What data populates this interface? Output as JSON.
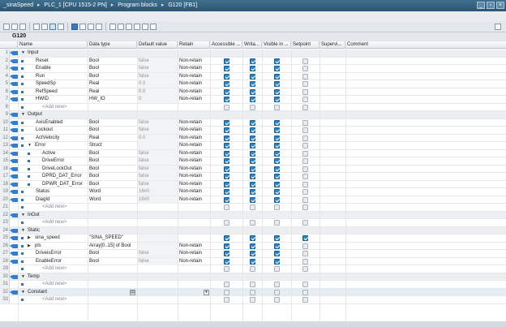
{
  "title": {
    "crumbs": [
      "_sinaSpeed",
      "PLC_1 [CPU 1515-2 PN]",
      "Program blocks",
      "G120 [FB1]"
    ],
    "separator": "▸",
    "window_buttons": [
      "_",
      "▫",
      "×"
    ]
  },
  "block_name": "G120",
  "columns": [
    "Name",
    "Data type",
    "Default value",
    "Retain",
    "Accessible ...",
    "Writa...",
    "Visible in ...",
    "Setpoint",
    "Supervi...",
    "Comment"
  ],
  "rows": [
    {
      "n": "1",
      "name": "Input",
      "section": true,
      "expand": "▼"
    },
    {
      "n": "2",
      "name": "Reset",
      "type": "Bool",
      "def": "false",
      "ret": "Non-retain",
      "acc": 1,
      "wr": 1,
      "vis": 1,
      "sp": 0
    },
    {
      "n": "3",
      "name": "Enable",
      "type": "Bool",
      "def": "false",
      "ret": "Non-retain",
      "acc": 1,
      "wr": 1,
      "vis": 1,
      "sp": 0
    },
    {
      "n": "4",
      "name": "Run",
      "type": "Bool",
      "def": "false",
      "ret": "Non-retain",
      "acc": 1,
      "wr": 1,
      "vis": 1,
      "sp": 0
    },
    {
      "n": "5",
      "name": "SpeedSp",
      "type": "Real",
      "def": "0.0",
      "ret": "Non-retain",
      "acc": 1,
      "wr": 1,
      "vis": 1,
      "sp": 0
    },
    {
      "n": "6",
      "name": "RefSpeed",
      "type": "Real",
      "def": "0.0",
      "ret": "Non-retain",
      "acc": 1,
      "wr": 1,
      "vis": 1,
      "sp": 0
    },
    {
      "n": "7",
      "name": "HWID",
      "type": "HW_IO",
      "def": "0",
      "ret": "Non-retain",
      "acc": 1,
      "wr": 1,
      "vis": 1,
      "sp": 0
    },
    {
      "n": "8",
      "name": "<Add new>",
      "add": true
    },
    {
      "n": "9",
      "name": "Output",
      "section": true,
      "expand": "▼"
    },
    {
      "n": "10",
      "name": "AxisEnabled",
      "type": "Bool",
      "def": "false",
      "ret": "Non-retain",
      "acc": 1,
      "wr": 1,
      "vis": 1,
      "sp": 0
    },
    {
      "n": "11",
      "name": "Lockout",
      "type": "Bool",
      "def": "false",
      "ret": "Non-retain",
      "acc": 1,
      "wr": 1,
      "vis": 1,
      "sp": 0
    },
    {
      "n": "12",
      "name": "ActVelocity",
      "type": "Real",
      "def": "0.0",
      "ret": "Non-retain",
      "acc": 1,
      "wr": 1,
      "vis": 1,
      "sp": 0
    },
    {
      "n": "13",
      "name": "Error",
      "type": "Struct",
      "def": "",
      "ret": "Non-retain",
      "acc": 1,
      "wr": 1,
      "vis": 1,
      "sp": 0,
      "expand": "▼"
    },
    {
      "n": "14",
      "name": "Active",
      "type": "Bool",
      "def": "false",
      "ret": "Non-retain",
      "acc": 1,
      "wr": 1,
      "vis": 1,
      "sp": 0,
      "indent": 2
    },
    {
      "n": "15",
      "name": "DriveError",
      "type": "Bool",
      "def": "false",
      "ret": "Non-retain",
      "acc": 1,
      "wr": 1,
      "vis": 1,
      "sp": 0,
      "indent": 2
    },
    {
      "n": "16",
      "name": "DriveLockOut",
      "type": "Bool",
      "def": "false",
      "ret": "Non-retain",
      "acc": 1,
      "wr": 1,
      "vis": 1,
      "sp": 0,
      "indent": 2
    },
    {
      "n": "17",
      "name": "DPRD_DAT_Error",
      "type": "Bool",
      "def": "false",
      "ret": "Non-retain",
      "acc": 1,
      "wr": 1,
      "vis": 1,
      "sp": 0,
      "indent": 2
    },
    {
      "n": "18",
      "name": "DPWR_DAT_Error",
      "type": "Bool",
      "def": "false",
      "ret": "Non-retain",
      "acc": 1,
      "wr": 1,
      "vis": 1,
      "sp": 0,
      "indent": 2
    },
    {
      "n": "19",
      "name": "Status",
      "type": "Word",
      "def": "16#0",
      "ret": "Non-retain",
      "acc": 1,
      "wr": 1,
      "vis": 1,
      "sp": 0
    },
    {
      "n": "20",
      "name": "DiagId",
      "type": "Word",
      "def": "16#0",
      "ret": "Non-retain",
      "acc": 1,
      "wr": 1,
      "vis": 1,
      "sp": 0
    },
    {
      "n": "21",
      "name": "<Add new>",
      "add": true
    },
    {
      "n": "22",
      "name": "InOut",
      "section": true,
      "expand": "▼"
    },
    {
      "n": "23",
      "name": "<Add new>",
      "add": true
    },
    {
      "n": "24",
      "name": "Static",
      "section": true,
      "expand": "▼"
    },
    {
      "n": "25",
      "name": "sina_speed",
      "type": "\"SINA_SPEED\"",
      "def": "",
      "ret": "",
      "acc": 1,
      "wr": 1,
      "vis": 1,
      "sp": 1,
      "expand": "▶"
    },
    {
      "n": "26",
      "name": "pls",
      "type": "Array[0..15] of Bool",
      "def": "",
      "ret": "Non-retain",
      "acc": 1,
      "wr": 1,
      "vis": 1,
      "sp": 0,
      "expand": "▶"
    },
    {
      "n": "27",
      "name": "DriveisError",
      "type": "Bool",
      "def": "false",
      "ret": "Non-retain",
      "acc": 1,
      "wr": 1,
      "vis": 1,
      "sp": 0
    },
    {
      "n": "28",
      "name": "EnableError",
      "type": "Bool",
      "def": "false",
      "ret": "Non-retain",
      "acc": 1,
      "wr": 1,
      "vis": 1,
      "sp": 0
    },
    {
      "n": "29",
      "name": "<Add new>",
      "add": true
    },
    {
      "n": "30",
      "name": "Temp",
      "section": true,
      "expand": "▼"
    },
    {
      "n": "31",
      "name": "<Add new>",
      "add": true
    },
    {
      "n": "32",
      "name": "Constant",
      "section": true,
      "expand": "▼",
      "selected": true
    },
    {
      "n": "33",
      "name": "<Add new>",
      "add": true
    }
  ]
}
